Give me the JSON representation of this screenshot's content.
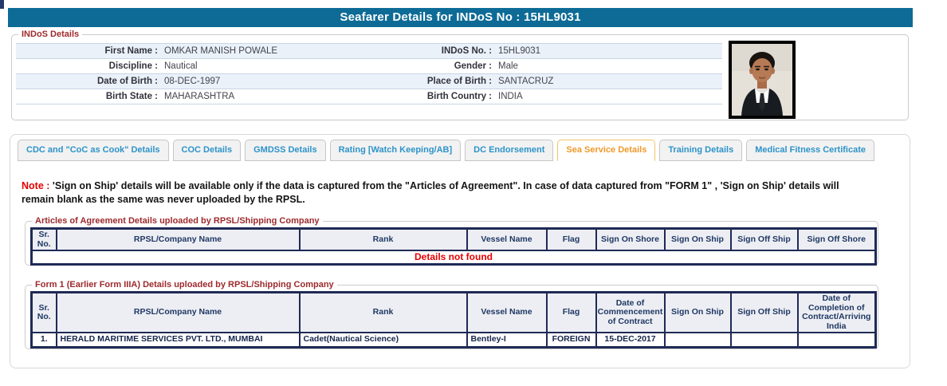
{
  "page": {
    "title": "Seafarer Details for INDoS No : 15HL9031"
  },
  "colors": {
    "title_bar": "#0d6b96",
    "legend_maroon": "#9d2a2c",
    "alert_red": "#e60000",
    "tab_blue": "#2d93c9",
    "tab_active_orange": "#ee9a28",
    "table_border_navy": "#1f2a55",
    "header_cell_bg": "#edeef3",
    "row_stripe_blue": "#eaf1f9"
  },
  "indos_details": {
    "legend": "INDoS Details",
    "rows": [
      {
        "label1": "First Name :",
        "value1": "OMKAR MANISH POWALE",
        "label2": "INDoS No. :",
        "value2": "15HL9031"
      },
      {
        "label1": "Discipline :",
        "value1": "Nautical",
        "label2": "Gender :",
        "value2": "Male"
      },
      {
        "label1": "Date of Birth :",
        "value1": "08-DEC-1997",
        "label2": "Place of Birth :",
        "value2": "SANTACRUZ"
      },
      {
        "label1": "Birth State :",
        "value1": "MAHARASHTRA",
        "label2": "Birth Country :",
        "value2": "INDIA"
      }
    ]
  },
  "tabs": [
    {
      "label": "CDC and \"CoC as Cook\" Details",
      "active": false
    },
    {
      "label": "COC Details",
      "active": false
    },
    {
      "label": "GMDSS Details",
      "active": false
    },
    {
      "label": "Rating [Watch Keeping/AB]",
      "active": false
    },
    {
      "label": "DC Endorsement",
      "active": false
    },
    {
      "label": "Sea Service Details",
      "active": true
    },
    {
      "label": "Training Details",
      "active": false
    },
    {
      "label": "Medical Fitness Certificate",
      "active": false
    }
  ],
  "note": {
    "label": "Note :",
    "line1": "'Sign on Ship' details will be available only if the data is captured from the \"Articles of Agreement\". In case of data captured from \"FORM 1\" , 'Sign on Ship' details will",
    "line2": "remain blank as the same was never uploaded by the RPSL."
  },
  "articles_table": {
    "legend": "Articles of Agreement Details uploaded by RPSL/Shipping Company",
    "headers": [
      "Sr. No.",
      "RPSL/Company Name",
      "Rank",
      "Vessel Name",
      "Flag",
      "Sign On Shore",
      "Sign On Ship",
      "Sign Off Ship",
      "Sign Off Shore"
    ],
    "empty_message": "Details not found"
  },
  "form1_table": {
    "legend": "Form 1 (Earlier Form IIIA) Details uploaded by RPSL/Shipping Company",
    "headers": [
      "Sr. No.",
      "RPSL/Company Name",
      "Rank",
      "Vessel Name",
      "Flag",
      "Date of Commencement of Contract",
      "Sign On Ship",
      "Sign Off Ship",
      "Date of Completion of Contract/Arriving India"
    ],
    "rows": [
      [
        "1.",
        "HERALD MARITIME SERVICES PVT. LTD., MUMBAI",
        "Cadet(Nautical Science)",
        "Bentley-I",
        "FOREIGN",
        "15-DEC-2017",
        "",
        "",
        ""
      ]
    ]
  }
}
